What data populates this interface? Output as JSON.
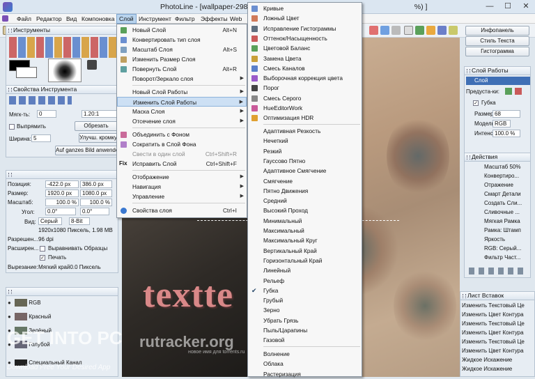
{
  "titlebar": {
    "title": "PhotoLine - [wallpaper-29845",
    "title_tail": "%) ]"
  },
  "menubar": {
    "items": [
      "Файл",
      "Редактор",
      "Вид",
      "Компоновка",
      "Слой",
      "Инструмент",
      "Фильтр",
      "Эффекты",
      "Web"
    ]
  },
  "left_panel": {
    "tools_title": "Инструменты",
    "props_title": "Свойства Инструмента",
    "hardness_label": "Мягк-ть:",
    "hardness_value": "0",
    "ratio_value": "1.20:1",
    "smooth_label": "Выпрямить",
    "crop_button": "Обрезать",
    "width_label": "Ширина:",
    "width_value": "5",
    "improve_button": "Улучш. кромку",
    "fit_button": "Auf ganzes Bild anwenden",
    "pos_label": "Позиция:",
    "pos_x": "-422.0 px",
    "pos_y": "386.0 px",
    "size_label": "Размер:",
    "size_x": "1920.0 px",
    "size_y": "1080.0 px",
    "scale_label": "Масштаб:",
    "scale_x": "100.0 %",
    "scale_y": "100.0 %",
    "angle_label": "Угол:",
    "angle_a": "0.0°",
    "angle_b": "0.0°",
    "view_label": "Вид:",
    "view_mode": "Серый",
    "view_bits": "8-Bit",
    "dims": "1920x1080 Пиксель, 1.98 MB",
    "res_label": "Разрешен...",
    "res_value": "96 dpi",
    "ext_label": "Расширен...",
    "align_label": "Выравнивать Образцы",
    "print_label": "Печать",
    "cut_label": "Вырезание:",
    "cut_value": "Мягкий край0.0 Пиксель",
    "channels": [
      "RGB",
      "Красный",
      "Зелёный",
      "Голубой"
    ],
    "special_channel": "Специальный Канал"
  },
  "canvas": {
    "overlay_text": "textte"
  },
  "layer_menu": {
    "items": [
      {
        "label": "Новый Слой",
        "shortcut": "Alt+N",
        "icon": "new-layer-icon"
      },
      {
        "label": "Конвертировать тип слоя",
        "shortcut": "",
        "icon": "convert-icon"
      },
      {
        "label": "Масштаб Слоя",
        "shortcut": "Alt+S",
        "icon": "scale-icon"
      },
      {
        "label": "Изменить Размер Слоя",
        "shortcut": "",
        "icon": "resize-icon"
      },
      {
        "label": "Повернуть Слой",
        "shortcut": "Alt+R",
        "icon": "rotate-icon"
      },
      {
        "label": "Поворот/Зеркало слоя",
        "shortcut": "",
        "icon": ""
      },
      {
        "label": "Новый Слой Работы",
        "shortcut": "",
        "icon": ""
      },
      {
        "label": "Изменить Слой Работы",
        "shortcut": "",
        "icon": ""
      },
      {
        "label": "Маска Слоя",
        "shortcut": "",
        "icon": ""
      },
      {
        "label": "Отсечение слоя",
        "shortcut": "",
        "icon": ""
      },
      {
        "label": "Объединить с Фоном",
        "shortcut": "",
        "icon": "merge-icon"
      },
      {
        "label": "Сократить в Слой Фона",
        "shortcut": "",
        "icon": "flatten-icon"
      },
      {
        "label": "Свести в один слой",
        "shortcut": "Ctrl+Shift+R",
        "icon": ""
      },
      {
        "label": "Исправить Слой",
        "shortcut": "Ctrl+Shift+F",
        "icon": "fix-icon",
        "icon_text": "Fix"
      },
      {
        "label": "Отображение",
        "shortcut": "",
        "icon": ""
      },
      {
        "label": "Навигация",
        "shortcut": "",
        "icon": ""
      },
      {
        "label": "Управление",
        "shortcut": "",
        "icon": ""
      },
      {
        "label": "Свойства слоя",
        "shortcut": "Ctrl+I",
        "icon": "info-icon"
      }
    ]
  },
  "sub_menu": {
    "items": [
      "Кривые",
      "Ложный Цвет",
      "Исправление Гистограммы",
      "Оттенок/Насыщенность",
      "Цветовой Баланс",
      "Замена Цвета",
      "Смесь Каналов",
      "Выборочная коррекция цвета",
      "Порог",
      "Смесь Серого",
      "HueEditorWork",
      "Оптимизация HDR",
      "Адаптивная Резкость",
      "Нечеткий",
      "Резкий",
      "Гауссово Пятно",
      "Адаптивное Смягчение",
      "Смягчение",
      "Пятно Движения",
      "Средний",
      "Высокий Проход",
      "Минимальный",
      "Максимальный",
      "Максимальный Круг",
      "Вертикальный Край",
      "Горизонтальный Край",
      "Линейный",
      "Рельеф",
      "Губка",
      "Грубый",
      "Зерно",
      "Убрать Грязь",
      "Пыль/Царапины",
      "Газовой",
      "Волнение",
      "Облака",
      "Растеризация"
    ]
  },
  "right_panel": {
    "tabs": [
      "Инфопанель",
      "Стиль Текста",
      "Гистограмма"
    ],
    "work_layer_title": "Слой Работы",
    "layer_label": "Слой",
    "preset_label": "Предуста-ки:",
    "filter_name": "Губка",
    "size_label": "Размер:",
    "size_value": "68",
    "model_label": "Модель:",
    "model_value": "RGB",
    "intensity_label": "Интенс:",
    "intensity_value": "100.0 %",
    "actions_title": "Действия",
    "actions": [
      "Масштаб 50%",
      "Конвертиро...",
      "Отражение",
      "Смарт Детали",
      "Создать Сли...",
      "Сливочные ...",
      "Мягкая Рамка",
      "Рамка: Штамп",
      "Яркость",
      "RGB: Серый...",
      "Фильтр Част..."
    ],
    "paste_title": "Лист Вставок",
    "paste_items": [
      "Изменить Текстовый Це",
      "Изменить Цвет Контура",
      "Изменить Текстовый Це",
      "Изменить Цвет Контура",
      "Изменить Текстовый Це",
      "Изменить Цвет Контура",
      "Жидкое Искажение",
      "Жидкое Искажение"
    ]
  },
  "watermark": {
    "line1": "GET INTO PC",
    "line2": "Download Free Your Desired App",
    "line3": "rutracker.org",
    "line4": "новое имя для torrents.ru"
  },
  "colors": {
    "menu_hl": "#cde0f4",
    "text_red": "#d98888"
  }
}
